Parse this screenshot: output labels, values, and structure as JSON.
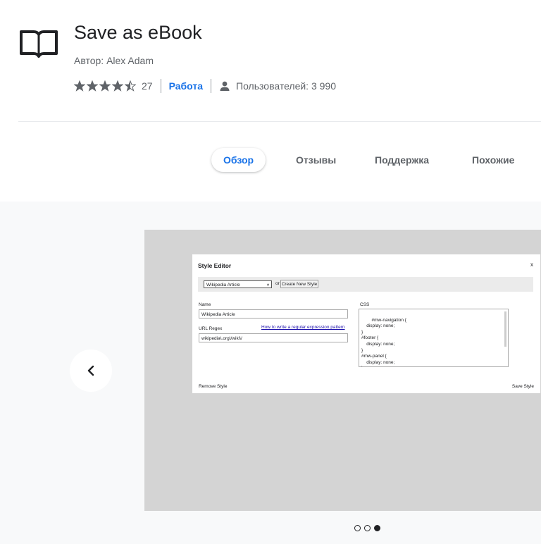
{
  "extension": {
    "title": "Save as eBook",
    "author": "Автор: Alex Adam",
    "rating": 4.5,
    "rating_count": "27",
    "category": "Работа",
    "users": "Пользователей: 3 990"
  },
  "tabs": [
    {
      "label": "Обзор",
      "active": true
    },
    {
      "label": "Отзывы",
      "active": false
    },
    {
      "label": "Поддержка",
      "active": false
    },
    {
      "label": "Похожие",
      "active": false
    }
  ],
  "gallery": {
    "current_slide": 3,
    "total_slides": 3,
    "screenshot": {
      "title": "Style Editor",
      "close": "x",
      "select_value": "Wikipedia Article",
      "or_text": "or",
      "create_button": "Create New Style",
      "name_label": "Name",
      "name_value": "Wikipedia Article",
      "url_label": "URL Regex",
      "url_help": "How to write a regular expression pattern",
      "url_value": "wikipedia\\.org\\/wiki\\/",
      "css_label": "CSS",
      "css_value": "#mw-navigation {\n    display: none;\n}\n#footer {\n    display: none;\n}\n#mw-panel {\n    display: none;\n}",
      "remove_button": "Remove Style",
      "save_button": "Save Style"
    }
  },
  "colors": {
    "accent": "#1a73e8",
    "text_secondary": "#5f6368",
    "gallery_bg": "#f8f9fa"
  }
}
